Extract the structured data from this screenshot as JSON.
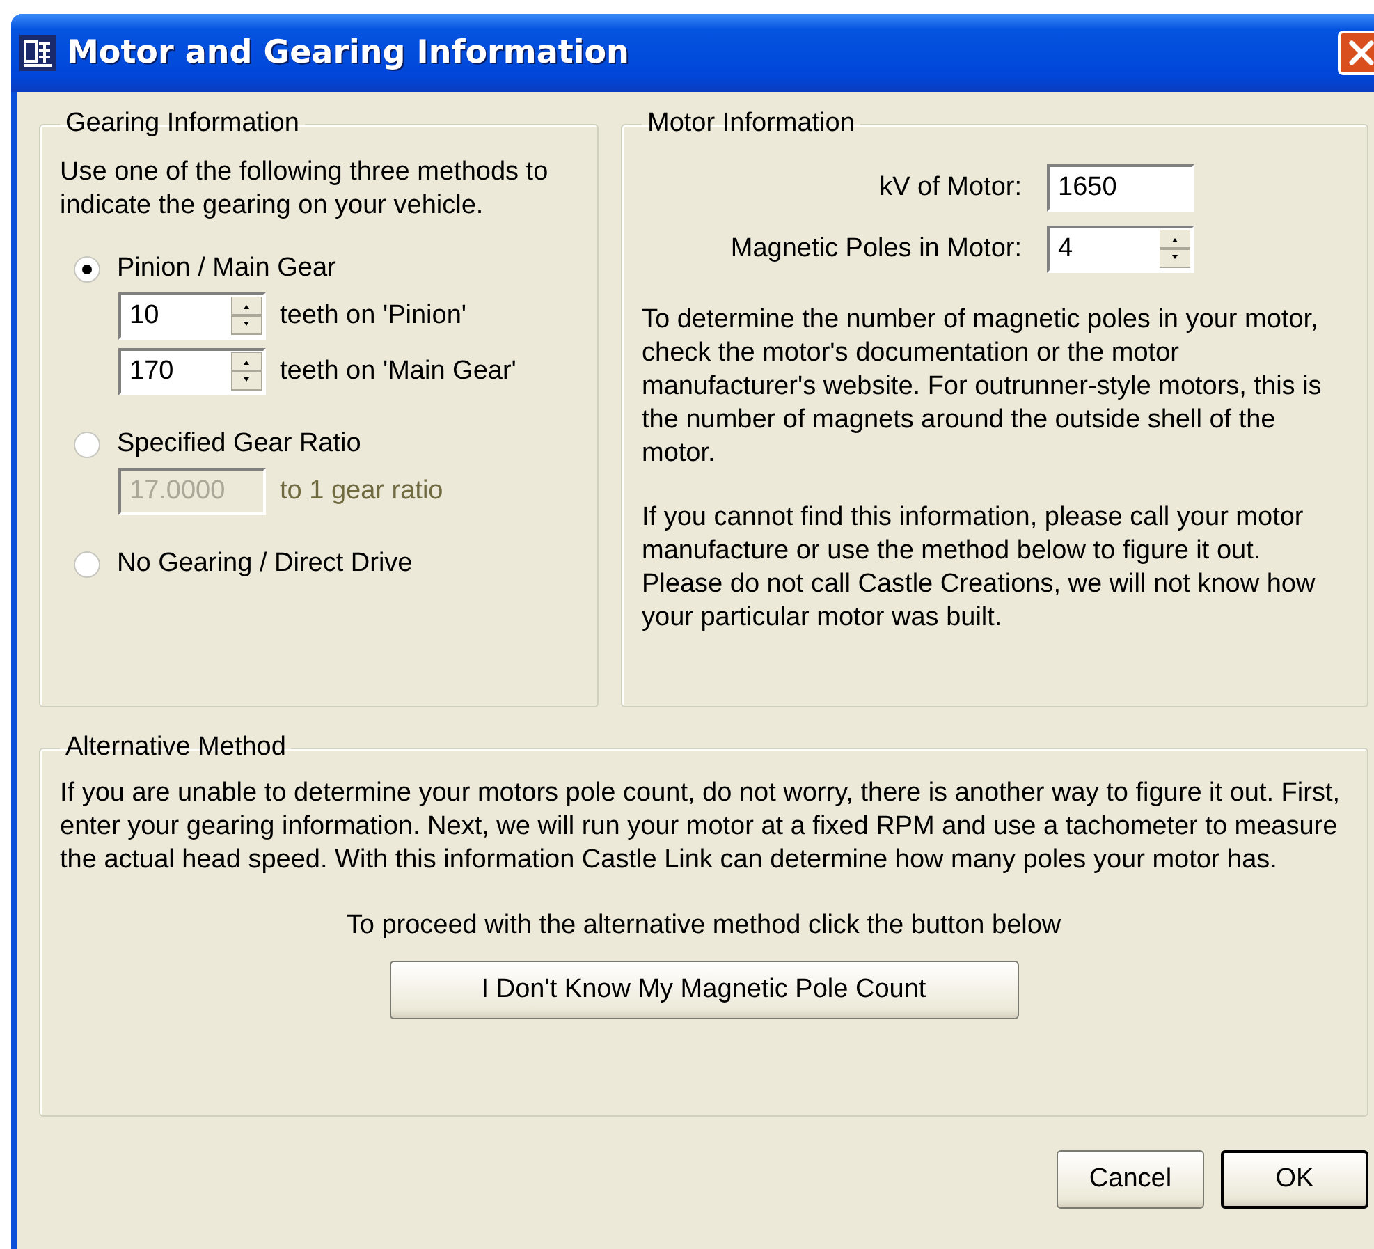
{
  "window": {
    "title": "Motor and Gearing Information"
  },
  "gearing": {
    "title": "Gearing Information",
    "intro": "Use one of the following three methods to indicate the gearing on your vehicle.",
    "options": [
      {
        "kind": "teeth",
        "label": "Pinion / Main Gear",
        "selected": true,
        "fields": [
          {
            "value": "10",
            "unit": "teeth on 'Pinion'"
          },
          {
            "value": "170",
            "unit": "teeth on 'Main Gear'"
          }
        ]
      },
      {
        "kind": "ratio",
        "label": "Specified Gear Ratio",
        "selected": false,
        "value": "17.0000",
        "unit": "to 1 gear ratio",
        "disabled": true
      },
      {
        "kind": "none",
        "label": "No Gearing / Direct Drive",
        "selected": false
      }
    ]
  },
  "motor": {
    "title": "Motor Information",
    "kv_label": "kV of Motor:",
    "kv_value": "1650",
    "poles_label": "Magnetic Poles in Motor:",
    "poles_value": "4",
    "paragraphs": [
      "To determine the number of magnetic poles in your motor, check the motor's documentation or the motor manufacturer's website.  For outrunner-style motors, this is the number of magnets around the outside shell of the motor.",
      "If you cannot find this information, please call your motor manufacture or use the method below to figure it out.  Please do not call Castle Creations, we will not know how your particular motor was built."
    ]
  },
  "alternative": {
    "title": "Alternative Method",
    "text": "If you are unable to determine your motors pole count, do not worry, there is another way to figure it out.  First, enter your gearing information.  Next, we will run your motor at a fixed RPM and use a tachometer to measure the actual head speed.  With this information Castle Link can determine how many poles your motor has.",
    "prompt": "To proceed with the alternative method click the button below",
    "button": "I Don't Know My Magnetic Pole Count"
  },
  "buttons": [
    {
      "label": "Cancel",
      "default": false
    },
    {
      "label": "OK",
      "default": true
    }
  ]
}
